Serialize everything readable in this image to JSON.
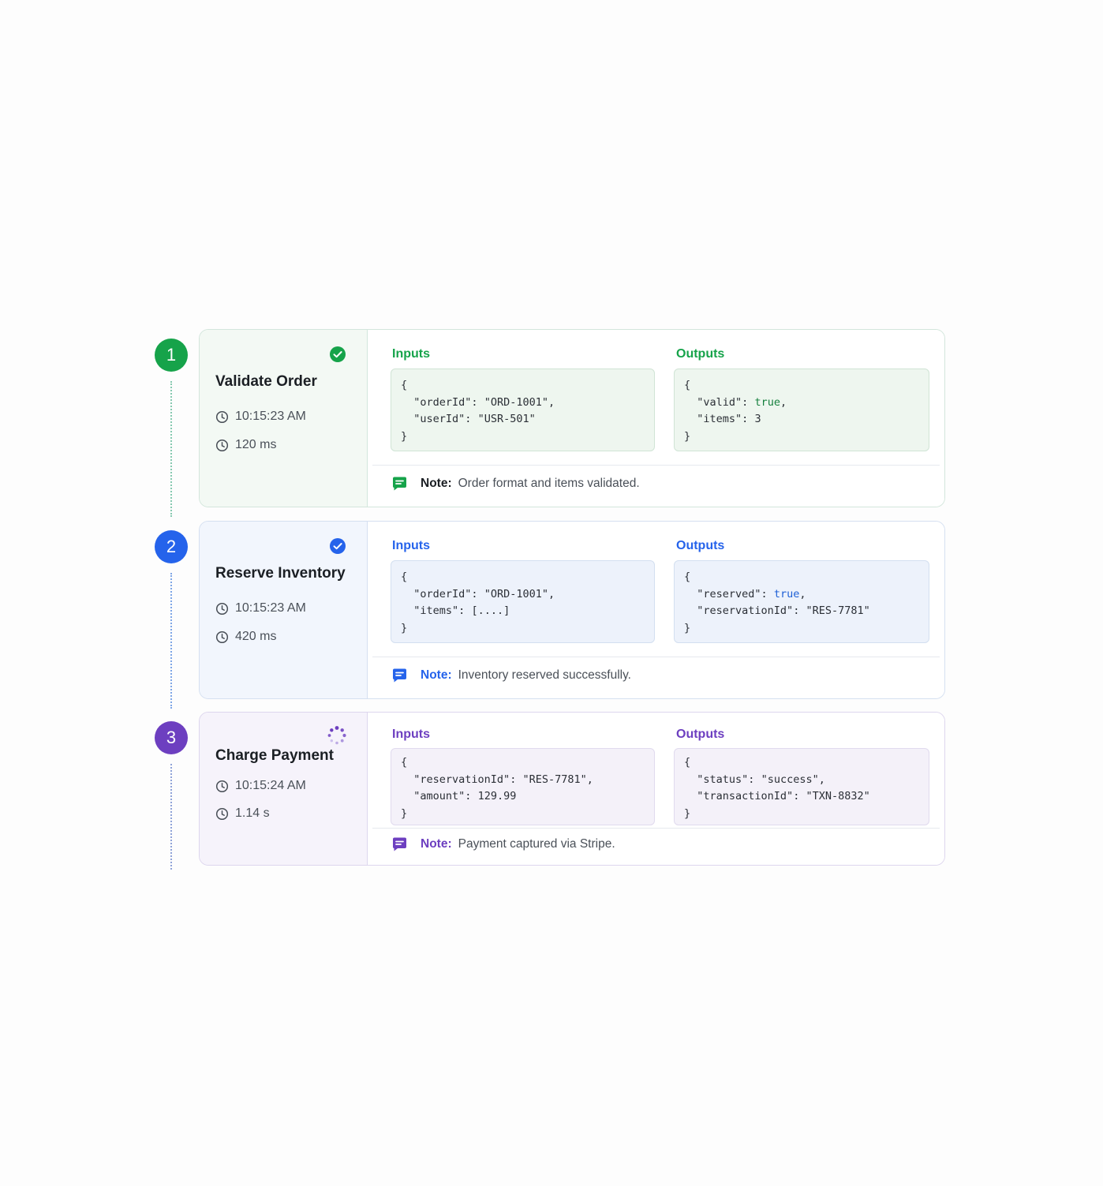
{
  "steps": [
    {
      "number": "1",
      "title": "Validate Order",
      "status": "completed",
      "timestamp": "10:15:23 AM",
      "duration": "120 ms",
      "inputs_label": "Inputs",
      "outputs_label": "Outputs",
      "inputs": {
        "open": "{",
        "line1_key": "\"orderId\"",
        "line1_sep": ": ",
        "line1_val": "\"ORD-1001\",",
        "line2_key": "\"userId\"",
        "line2_sep": ": ",
        "line2_val": "\"USR-501\"",
        "close": "}"
      },
      "outputs": {
        "open": "{",
        "line1_key": "\"valid\"",
        "line1_sep": ": ",
        "line1_val": "true",
        "line1_tail": ",",
        "line2_key": "\"items\"",
        "line2_sep": ": ",
        "line2_val": "3",
        "close": "}"
      },
      "note_label": "Note:",
      "note_text": "Order format and items validated.",
      "color": "#16a34a"
    },
    {
      "number": "2",
      "title": "Reserve Inventory",
      "status": "completed",
      "timestamp": "10:15:23 AM",
      "duration": "420 ms",
      "inputs_label": "Inputs",
      "outputs_label": "Outputs",
      "inputs": {
        "open": "{",
        "line1_key": "\"orderId\"",
        "line1_sep": ": ",
        "line1_val": "\"ORD-1001\",",
        "line2_key": "\"items\"",
        "line2_sep": ": ",
        "line2_val": "[....]",
        "close": "}"
      },
      "outputs": {
        "open": "{",
        "line1_key": "\"reserved\"",
        "line1_sep": ": ",
        "line1_val": "true",
        "line1_tail": ",",
        "line2_key": "\"reservationId\"",
        "line2_sep": ": ",
        "line2_val": "\"RES-7781\"",
        "close": "}"
      },
      "note_label": "Note:",
      "note_text": "Inventory reserved successfully.",
      "color": "#2563eb"
    },
    {
      "number": "3",
      "title": "Charge Payment",
      "status": "in-progress",
      "timestamp": "10:15:24 AM",
      "duration": "1.14 s",
      "inputs_label": "Inputs",
      "outputs_label": "Outputs",
      "inputs": {
        "open": "{",
        "line1_key": "\"reservationId\"",
        "line1_sep": ": ",
        "line1_val": "\"RES-7781\",",
        "line2_key": "\"amount\"",
        "line2_sep": ": ",
        "line2_val": "129.99",
        "close": "}"
      },
      "outputs": {
        "open": "{",
        "line1_key": "\"status\"",
        "line1_sep": ": ",
        "line1_val": "\"success\",",
        "line2_key": "\"transactionId\"",
        "line2_sep": ": ",
        "line2_val": "\"TXN-8832\"",
        "close": "}"
      },
      "note_label": "Note:",
      "note_text": "Payment captured via Stripe.",
      "color": "#6d3fc0"
    }
  ]
}
